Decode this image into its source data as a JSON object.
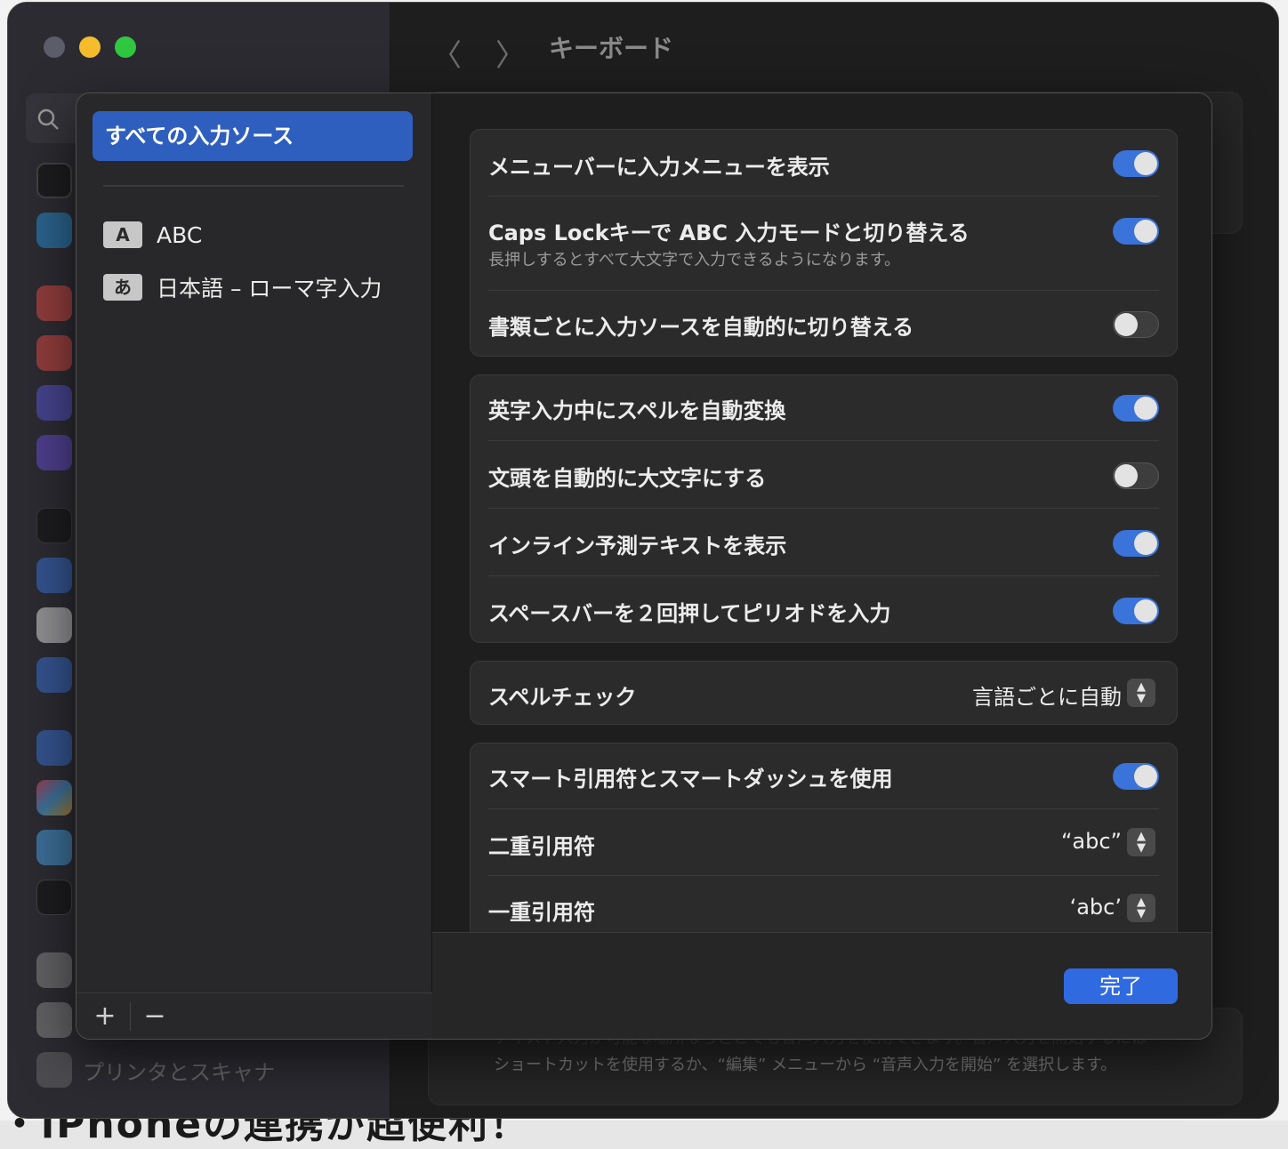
{
  "window": {
    "title": "キーボード",
    "nav_back": "〈",
    "nav_forward": "〉"
  },
  "desktop": {
    "bottom_text": "・iPhoneの連携が超便利！"
  },
  "sidebar": {
    "search_icon": "magnifier-icon",
    "icons": [
      "appearance-icon",
      "accessibility-icon",
      "notifications-icon",
      "sound-icon",
      "focus-icon",
      "screen-time-icon",
      "lock-screen-icon",
      "privacy-icon",
      "touch-id-icon",
      "users-icon",
      "internet-accounts-icon",
      "game-center-icon",
      "icloud-icon",
      "wallet-icon",
      "keyboard-icon",
      "trackpad-icon"
    ],
    "printer_label": "プリンタとスキャナ"
  },
  "background": {
    "line1": "テキスト入力が可能な場所ならどこでも音声入力を使用できます。音声入力を開始するには",
    "line2": "ショートカットを使用するか、“編集” メニューから “音声入力を開始” を選択します。"
  },
  "sources": {
    "all_label": "すべての入力ソース",
    "items": [
      {
        "badge": "A",
        "label": "ABC"
      },
      {
        "badge": "あ",
        "label": "日本語 – ローマ字入力"
      }
    ],
    "add": "+",
    "remove": "−"
  },
  "settings": {
    "group1": [
      {
        "label": "メニューバーに入力メニューを表示",
        "on": true
      },
      {
        "label": "Caps Lockキーで ABC 入力モードと切り替える",
        "sub": "長押しするとすべて大文字で入力できるようになります。",
        "on": true
      },
      {
        "label": "書類ごとに入力ソースを自動的に切り替える",
        "on": false
      }
    ],
    "group2": [
      {
        "label": "英字入力中にスペルを自動変換",
        "on": true
      },
      {
        "label": "文頭を自動的に大文字にする",
        "on": false
      },
      {
        "label": "インライン予測テキストを表示",
        "on": true
      },
      {
        "label": "スペースバーを２回押してピリオドを入力",
        "on": true
      }
    ],
    "spell_check": {
      "label": "スペルチェック",
      "value": "言語ごとに自動"
    },
    "group4": {
      "smart_label": "スマート引用符とスマートダッシュを使用",
      "smart_on": true,
      "double_label": "二重引用符",
      "double_value": "“abc”",
      "single_label": "一重引用符",
      "single_value": "‘abc’"
    },
    "toggle_on_color": "#3a73d9"
  },
  "footer": {
    "done": "完了"
  }
}
